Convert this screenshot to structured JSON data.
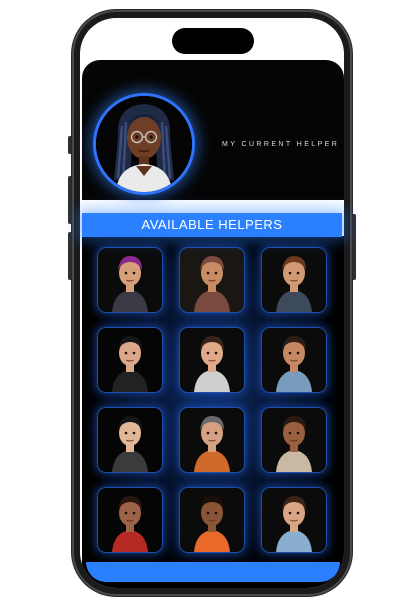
{
  "current_helper": {
    "label": "MY CURRENT HELPER",
    "avatar_icon": "woman-braids-glasses-avatar",
    "accent_color": "#2e74ff"
  },
  "available_helpers": {
    "banner_label": "AVAILABLE HELPERS",
    "banner_color": "#2b80ff",
    "helpers": [
      {
        "id": "h1",
        "icon": "punk-girl-purple-hair-avatar",
        "skin": "#d8a07a",
        "hair": "#8a2a8e",
        "shirt": "#3a3a44",
        "bg": "#0b0b0b"
      },
      {
        "id": "h2",
        "icon": "woman-hijab-avatar",
        "skin": "#c88b64",
        "hair": "#7a4a3e",
        "shirt": "#7a4a3e",
        "bg": "#1a1612"
      },
      {
        "id": "h3",
        "icon": "young-man-curly-hair-avatar",
        "skin": "#d29a74",
        "hair": "#6a3a1e",
        "shirt": "#3c4a5c",
        "bg": "#0b0b0b"
      },
      {
        "id": "h4",
        "icon": "man-black-jacket-avatar",
        "skin": "#dba889",
        "hair": "#151515",
        "shirt": "#222",
        "bg": "#050505"
      },
      {
        "id": "h5",
        "icon": "woman-glasses-avatar",
        "skin": "#e0aa88",
        "hair": "#3a231a",
        "shirt": "#cfcfcf",
        "bg": "#0b0b0b"
      },
      {
        "id": "h6",
        "icon": "bald-man-beard-avatar",
        "skin": "#c68860",
        "hair": "#2b1e18",
        "shirt": "#7a9cbc",
        "bg": "#0b0b0b"
      },
      {
        "id": "h7",
        "icon": "boy-hoodie-avatar",
        "skin": "#e2b797",
        "hair": "#151515",
        "shirt": "#3b3b3b",
        "bg": "#050505"
      },
      {
        "id": "h8",
        "icon": "bearded-man-glasses-avatar",
        "skin": "#d6a082",
        "hair": "#6a6a6a",
        "shirt": "#d06a2a",
        "bg": "#0b0b0b"
      },
      {
        "id": "h9",
        "icon": "man-dreadlocks-avatar",
        "skin": "#9a5f3e",
        "hair": "#2a1a12",
        "shirt": "#c9b9a2",
        "bg": "#0b0b0b"
      },
      {
        "id": "h10",
        "icon": "woman-red-sweater-avatar",
        "skin": "#9c6346",
        "hair": "#2a160e",
        "shirt": "#b52a22",
        "bg": "#050505"
      },
      {
        "id": "h11",
        "icon": "girl-afro-puffs-avatar",
        "skin": "#8a5436",
        "hair": "#1a0e08",
        "shirt": "#e8692a",
        "bg": "#0b0b0b"
      },
      {
        "id": "h12",
        "icon": "man-beard-blue-shirt-avatar",
        "skin": "#d9a585",
        "hair": "#3a241a",
        "shirt": "#8aaed0",
        "bg": "#0b0b0b"
      }
    ]
  }
}
